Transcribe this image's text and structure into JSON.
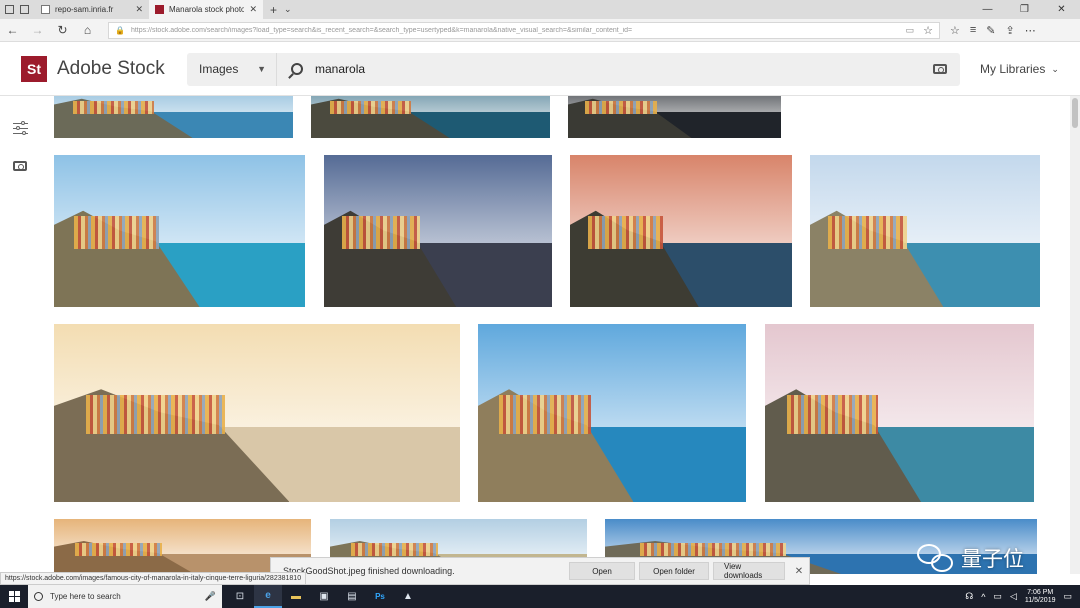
{
  "browser": {
    "tabs": [
      {
        "label": "repo-sam.inria.fr",
        "close": "✕"
      },
      {
        "label": "Manarola stock photos",
        "close": "✕"
      }
    ],
    "new_tab": "+",
    "tab_menu": "⌄",
    "window_controls": [
      "—",
      "❐",
      "✕"
    ],
    "nav": {
      "back": "←",
      "forward": "→",
      "refresh": "↻",
      "home": "⌂"
    },
    "url": "https://stock.adobe.com/search/images?load_type=search&is_recent_search=&search_type=usertyped&k=manarola&native_visual_search=&similar_content_id=",
    "tools": [
      "☆",
      "≡",
      "✎",
      "⇪",
      "⋯"
    ]
  },
  "stock": {
    "logo": "St",
    "brand": "Adobe Stock",
    "search_type": "Images",
    "search_query": "manarola",
    "libraries_label": "My Libraries"
  },
  "rail": {
    "icons": [
      "filter-icon",
      "camera-icon"
    ]
  },
  "images": [
    {
      "title": "manarola-thumb-1",
      "sky": "#7fb4d6",
      "sea": "#3b87b4",
      "cliff": "#6b6a58"
    },
    {
      "title": "manarola-thumb-2",
      "sky": "#4b7d93",
      "sea": "#1e5a73",
      "cliff": "#4b4a3e"
    },
    {
      "title": "manarola-thumb-3",
      "sky": "#2e3238",
      "sea": "#20242a",
      "cliff": "#3a3a34"
    },
    {
      "title": "manarola-thumb-4",
      "sky": "#8ec2e6",
      "sea": "#2aa0c4",
      "cliff": "#7e7456"
    },
    {
      "title": "manarola-thumb-5",
      "sky": "#556b95",
      "sea": "#3b3f4f",
      "cliff": "#3e3c36"
    },
    {
      "title": "manarola-thumb-6",
      "sky": "#d8846a",
      "sea": "#2c4e6a",
      "cliff": "#3d3c33"
    },
    {
      "title": "manarola-thumb-7",
      "sky": "#c3d8ec",
      "sea": "#3d8fb0",
      "cliff": "#8b8266"
    },
    {
      "title": "manarola-thumb-8",
      "sky": "#f3ddb2",
      "sea": "#d9c7a8",
      "cliff": "#7b6d55"
    },
    {
      "title": "manarola-thumb-9",
      "sky": "#5fa8dd",
      "sea": "#2688be",
      "cliff": "#8f7e5c"
    },
    {
      "title": "manarola-thumb-10",
      "sky": "#e4c7cf",
      "sea": "#3d8aa4",
      "cliff": "#615c4d"
    },
    {
      "title": "manarola-thumb-11",
      "sky": "#e6b47a",
      "sea": "#b8926b",
      "cliff": "#8b6a47"
    },
    {
      "title": "manarola-thumb-12",
      "sky": "#b3cfe3",
      "sea": "#c2b690",
      "cliff": "#7d7458"
    },
    {
      "title": "manarola-thumb-13",
      "sky": "#4a8cc9",
      "sea": "#2d73b0",
      "cliff": "#6f6a58"
    }
  ],
  "status_url": "https://stock.adobe.com/images/famous-city-of-manarola-in-italy-cinque-terre-liguria/282381810",
  "download": {
    "message": "StockGoodShot.jpeg finished downloading.",
    "open": "Open",
    "open_folder": "Open folder",
    "view_downloads": "View downloads",
    "close": "✕"
  },
  "watermark": {
    "text": "量子位"
  },
  "taskbar": {
    "search_placeholder": "Type here to search",
    "mic": "🎤",
    "apps": [
      "⊡",
      "e",
      "▬",
      "▣",
      "▤",
      "Ps",
      "▲"
    ],
    "time": "7:06 PM",
    "date": "11/5/2019",
    "tray": [
      "☊",
      "^",
      "▭",
      "◁"
    ]
  },
  "colors": {
    "brand": "#9c1b2c",
    "taskbar": "#1a1f2b",
    "accent": "#4ca3e8"
  }
}
